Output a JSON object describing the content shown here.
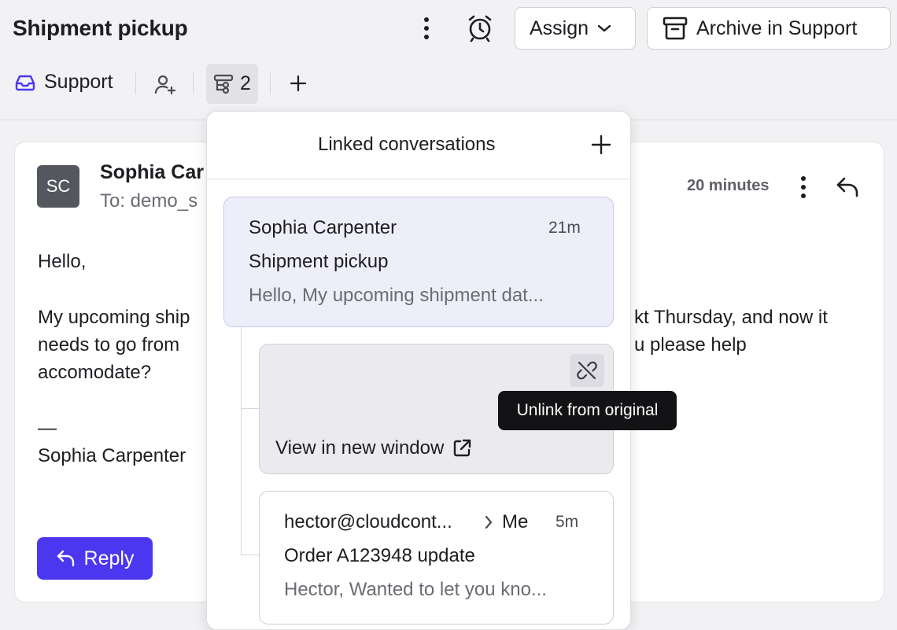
{
  "header": {
    "title": "Shipment pickup",
    "assign_label": "Assign",
    "archive_label": "Archive in Support"
  },
  "toolbar": {
    "inbox_label": "Support",
    "linked_count": "2"
  },
  "message": {
    "avatar_initials": "SC",
    "sender": "Sophia Car",
    "to": "To: demo_s",
    "time": "20 minutes",
    "greeting": "Hello,",
    "line1_left": "My upcoming ship",
    "line1_right": "kt Thursday, and now it",
    "line2_left": "needs to go from",
    "line2_right": "u please help",
    "line3": "accomodate?",
    "dash": "—",
    "signature": "Sophia Carpenter",
    "reply_label": "Reply"
  },
  "linked": {
    "title": "Linked conversations",
    "items": [
      {
        "from": "Sophia Carpenter",
        "time": "21m",
        "subject": "Shipment pickup",
        "preview": "Hello, My upcoming shipment dat..."
      },
      {
        "view_label": "View in new window",
        "tooltip": "Unlink from original"
      },
      {
        "from": "hector@cloudcont...",
        "to": "Me",
        "time": "5m",
        "subject": "Order A123948 update",
        "preview": "Hector, Wanted to let you kno..."
      }
    ]
  },
  "icons": [
    "more-vertical-icon",
    "alarm-clock-icon",
    "chevron-down-icon",
    "archive-icon",
    "inbox-icon",
    "user-plus-icon",
    "linked-conversations-icon",
    "plus-icon",
    "reply-icon",
    "unlink-icon",
    "external-link-icon",
    "chevron-right-icon"
  ],
  "colors": {
    "accent": "#4b37f0",
    "selected_card": "#eeeefa",
    "tooltip_bg": "#131316"
  }
}
